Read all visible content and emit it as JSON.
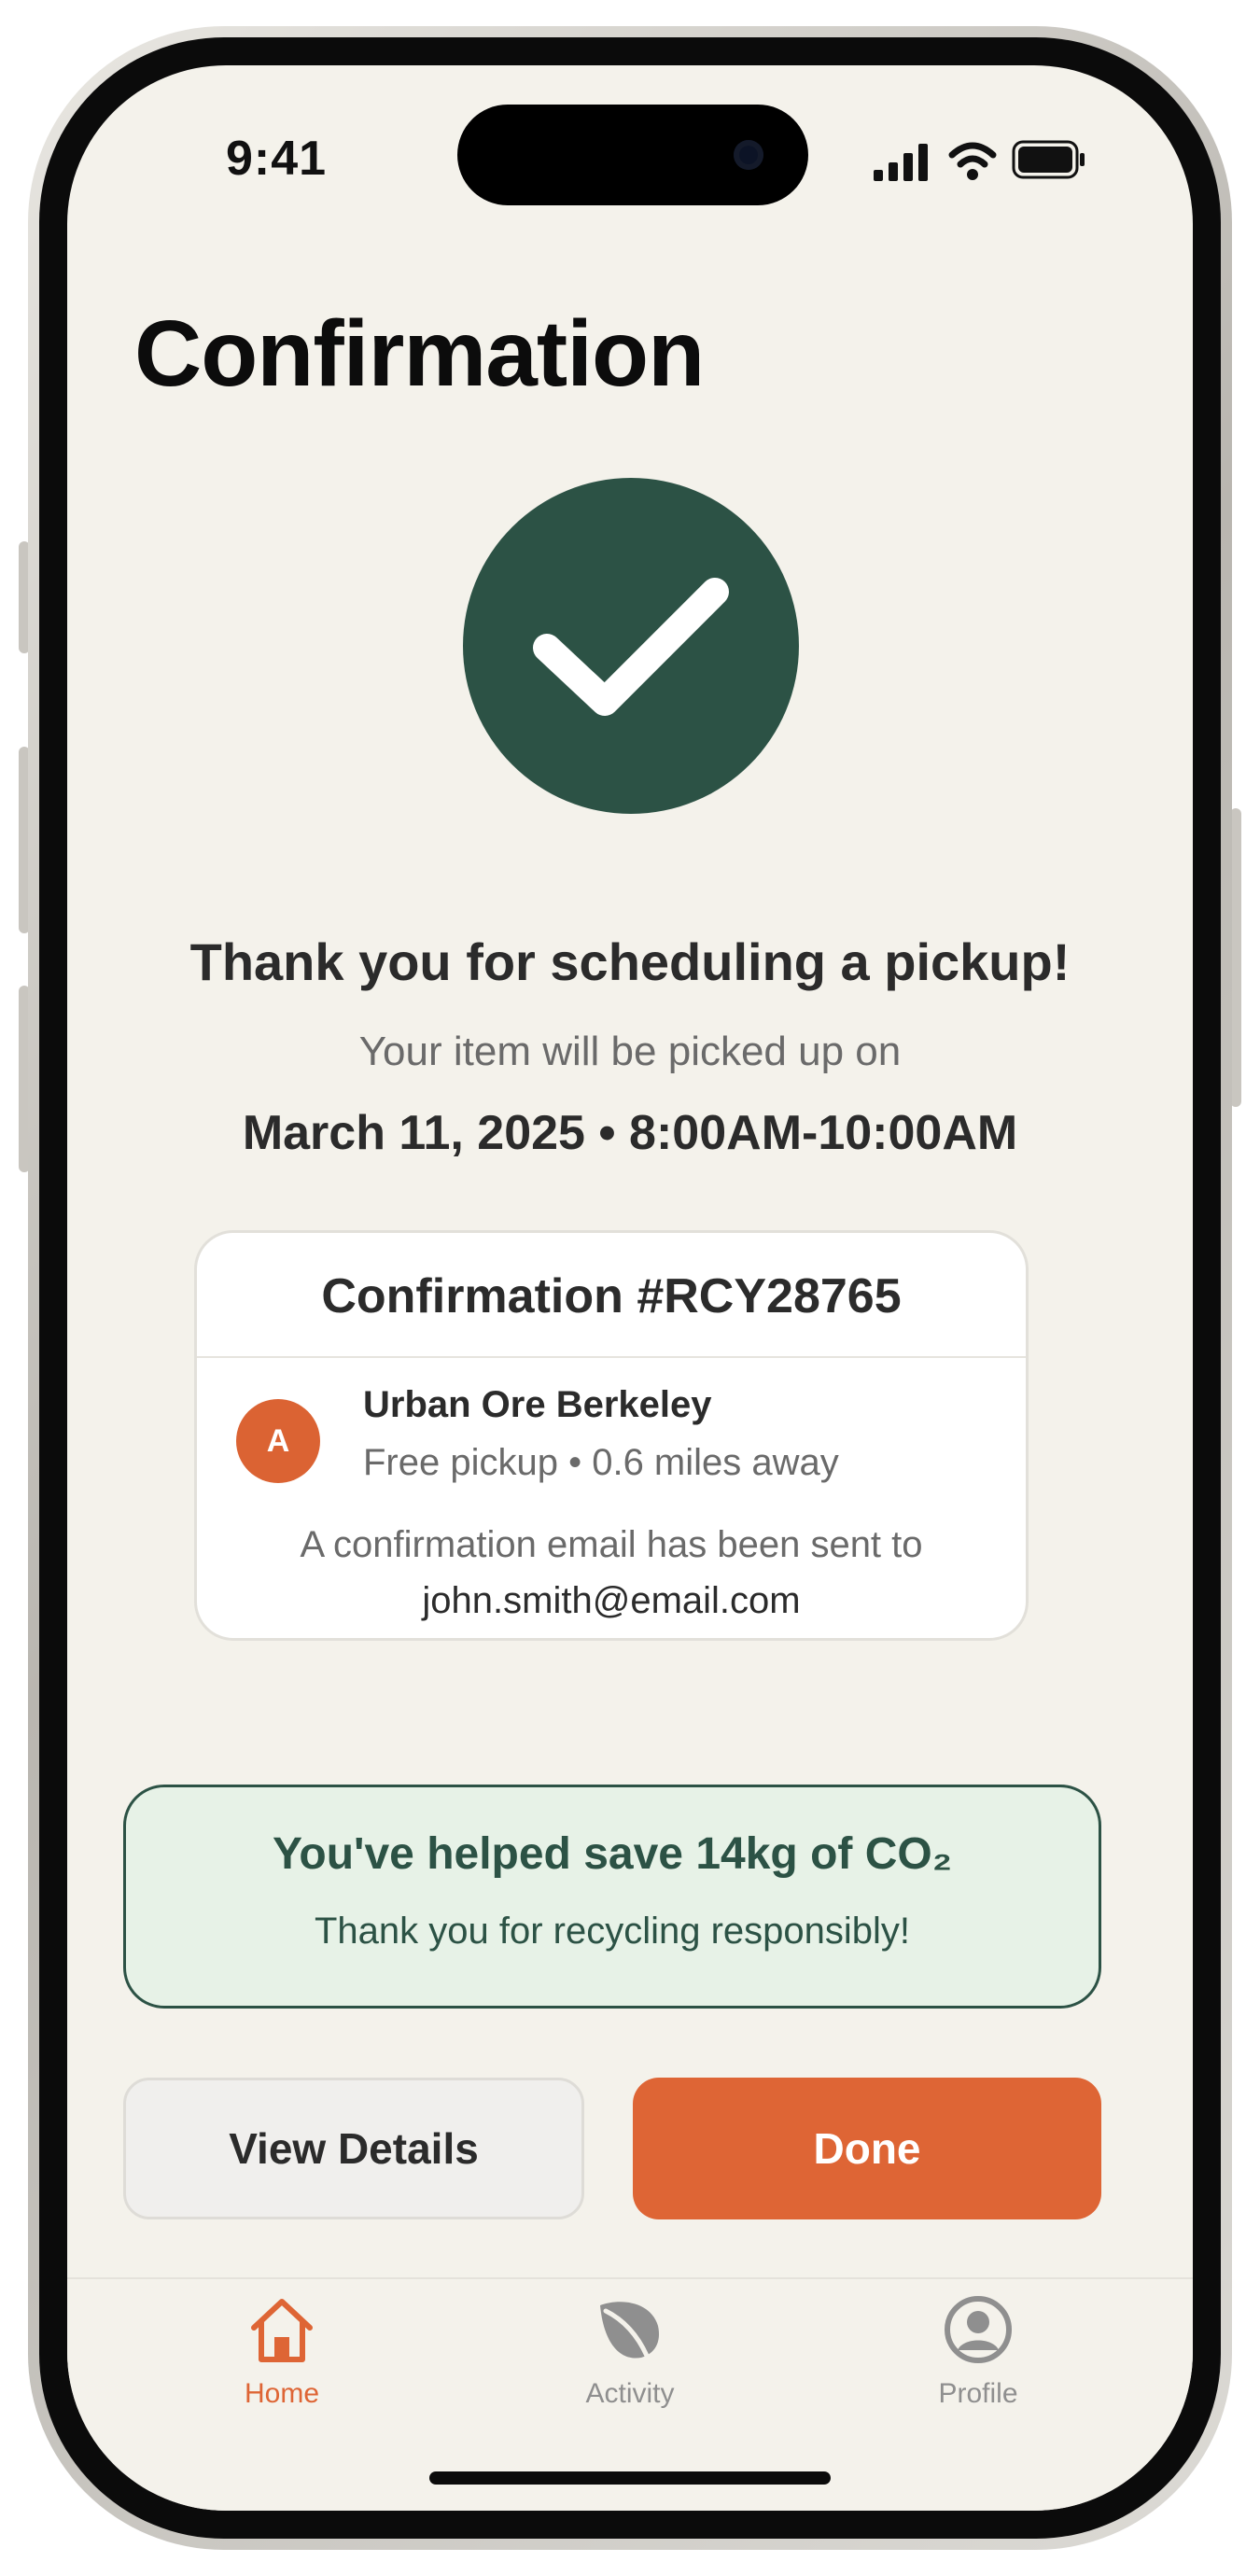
{
  "status_bar": {
    "time": "9:41"
  },
  "page": {
    "title": "Confirmation"
  },
  "confirmation": {
    "heading": "Thank you for scheduling a pickup!",
    "subheading": "Your item will be picked up on",
    "datetime": "March 11, 2025 • 8:00AM-10:00AM"
  },
  "card": {
    "title": "Confirmation #RCY28765",
    "avatar_letter": "A",
    "org_name": "Urban Ore Berkeley",
    "org_meta": "Free pickup • 0.6 miles away",
    "email_note": "A confirmation email has been sent to",
    "email": "john.smith@email.com"
  },
  "impact": {
    "title": "You've helped save 14kg of CO₂",
    "subtitle": "Thank you for recycling responsibly!"
  },
  "actions": {
    "secondary_label": "View Details",
    "primary_label": "Done"
  },
  "tabbar": {
    "items": [
      {
        "label": "Home",
        "icon": "home-icon",
        "active": true
      },
      {
        "label": "Activity",
        "icon": "leaf-icon",
        "active": false
      },
      {
        "label": "Profile",
        "icon": "profile-icon",
        "active": false
      }
    ]
  },
  "colors": {
    "background": "#f4f2eb",
    "primary_green": "#2c5245",
    "accent_orange": "#de6535",
    "impact_bg": "#e7f2e7",
    "inactive_gray": "#8f8f8f"
  }
}
